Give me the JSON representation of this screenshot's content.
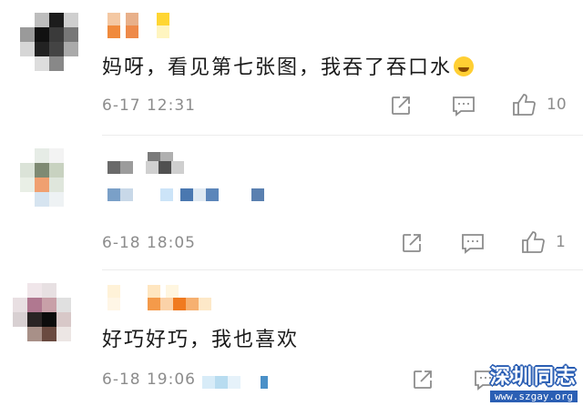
{
  "comments": [
    {
      "text": "妈呀，看见第七张图，我吞了吞口水",
      "time": "6-17 12:31",
      "likes": "10",
      "emoji_icon": "laughing-crying-emoji"
    },
    {
      "text": "",
      "time": "6-18 18:05",
      "likes": "1"
    },
    {
      "text": "好巧好巧，我也喜欢",
      "time": "6-18 19:06",
      "likes": ""
    }
  ],
  "watermark": {
    "title": "深圳同志",
    "url": "www.szgay.org"
  },
  "colors": {
    "text": "#1a1a1a",
    "meta": "#8c8c8c",
    "watermark_blue": "#2b5fb4"
  },
  "icons": [
    "share-icon",
    "comment-icon",
    "like-icon"
  ]
}
